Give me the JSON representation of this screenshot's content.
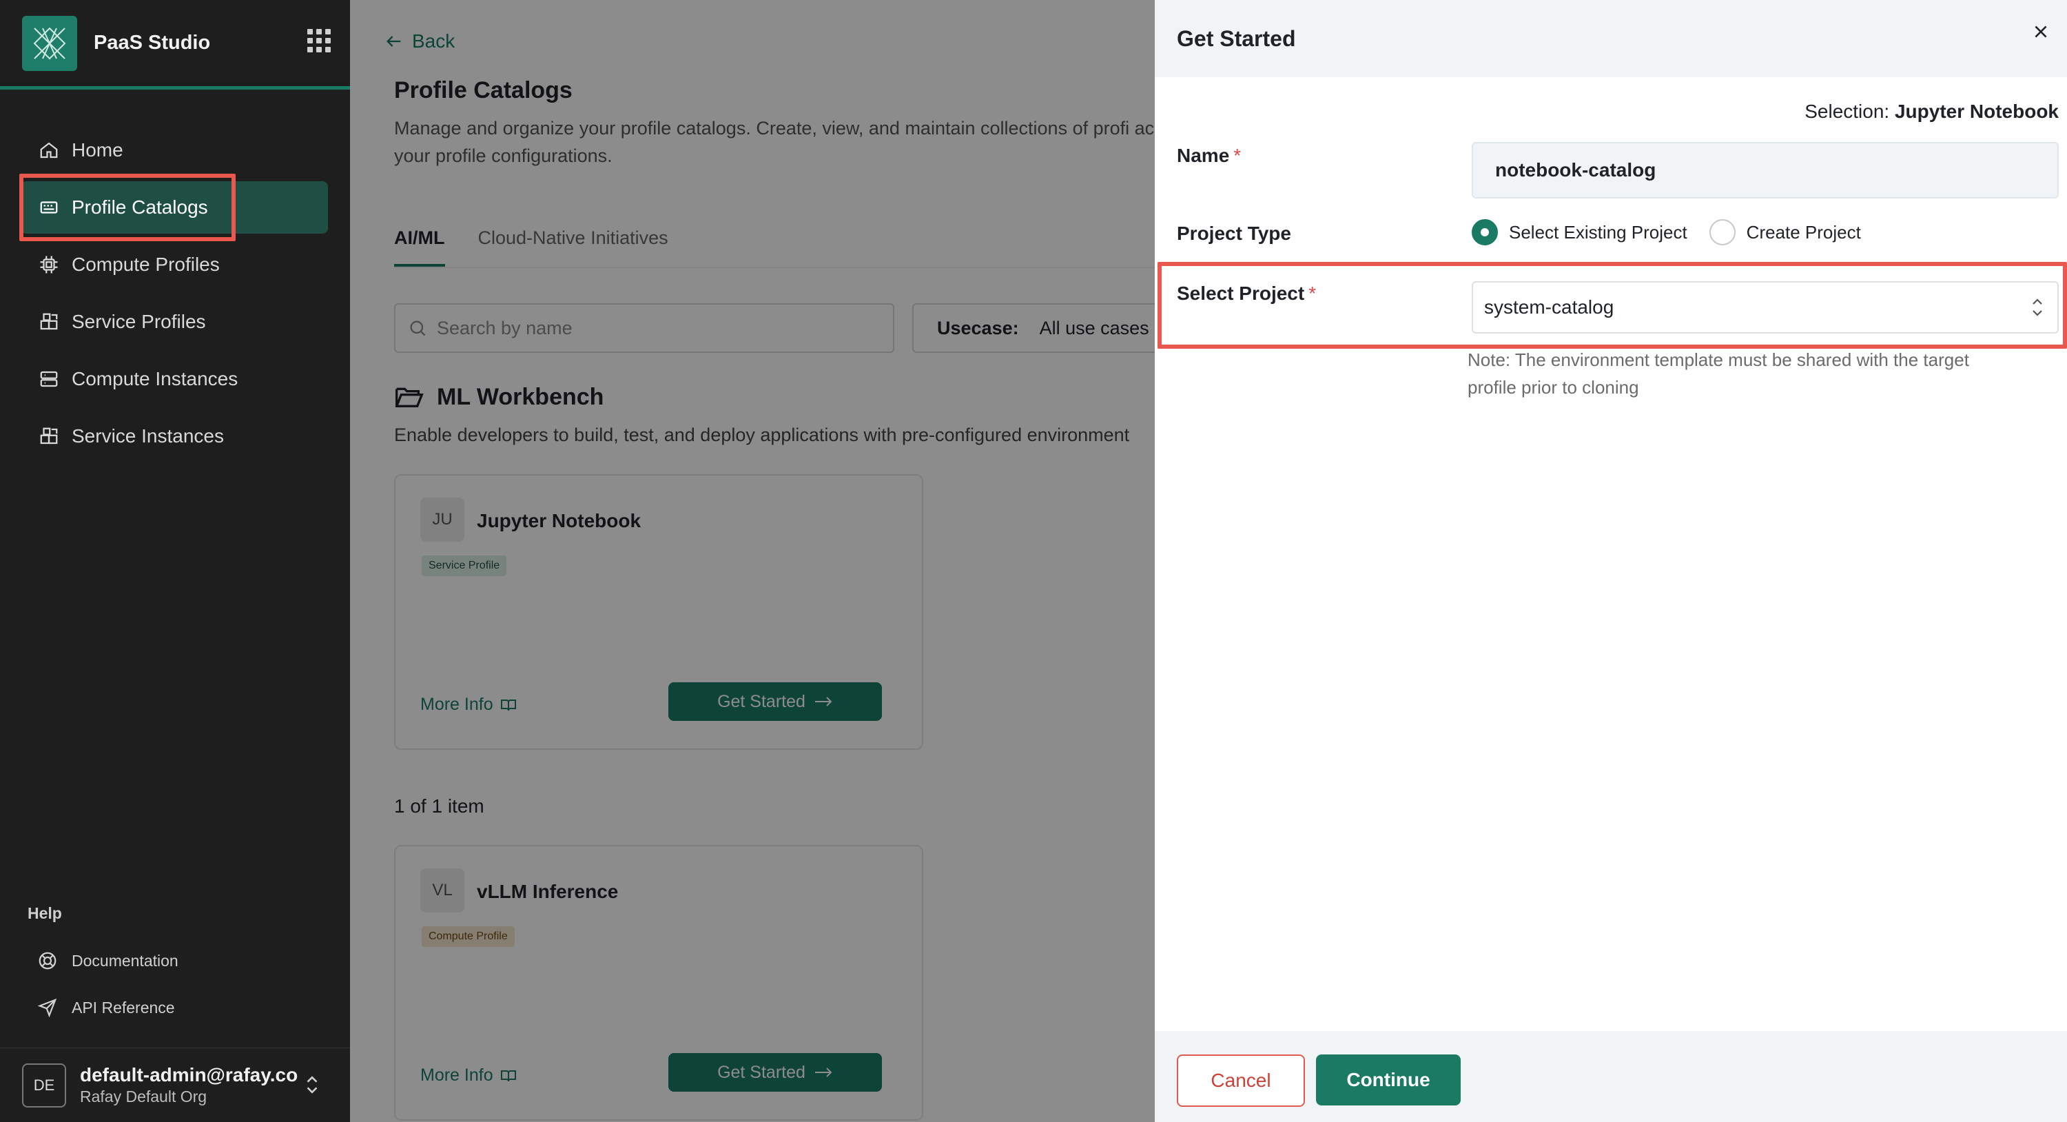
{
  "sidebar": {
    "brand": "PaaS Studio",
    "nav": [
      {
        "label": "Home",
        "icon": "home-icon"
      },
      {
        "label": "Profile Catalogs",
        "icon": "catalog-icon",
        "active": true
      },
      {
        "label": "Compute Profiles",
        "icon": "cpu-icon"
      },
      {
        "label": "Service Profiles",
        "icon": "blocks-icon"
      },
      {
        "label": "Compute Instances",
        "icon": "server-icon"
      },
      {
        "label": "Service Instances",
        "icon": "blocks-icon"
      }
    ],
    "help": {
      "label": "Help",
      "items": [
        {
          "label": "Documentation",
          "icon": "lifebuoy-icon"
        },
        {
          "label": "API Reference",
          "icon": "send-icon"
        }
      ]
    },
    "user": {
      "initials": "DE",
      "email": "default-admin@rafay.co",
      "org": "Rafay Default Org"
    }
  },
  "main": {
    "back": "Back",
    "title": "Profile Catalogs",
    "description": "Manage and organize your profile catalogs. Create, view, and maintain collections of profi access your profile configurations.",
    "tabs": [
      {
        "label": "AI/ML",
        "active": true
      },
      {
        "label": "Cloud-Native Initiatives"
      }
    ],
    "search_placeholder": "Search by name",
    "usecase": {
      "label": "Usecase:",
      "value": "All use cases"
    },
    "section": {
      "title": "ML Workbench",
      "description": "Enable developers to build, test, and deploy applications with pre-configured environment"
    },
    "cards": [
      {
        "initials": "JU",
        "title": "Jupyter Notebook",
        "badge": "Service Profile",
        "more_info": "More Info",
        "button": "Get Started"
      },
      {
        "initials": "VL",
        "title": "vLLM Inference",
        "badge": "Compute Profile",
        "more_info": "More Info",
        "button": "Get Started"
      }
    ],
    "pager": "1 of 1 item"
  },
  "drawer": {
    "title": "Get Started",
    "selection_label": "Selection:",
    "selection_value": "Jupyter Notebook",
    "name_label": "Name",
    "name_value": "notebook-catalog",
    "project_type_label": "Project Type",
    "radio_existing": "Select Existing Project",
    "radio_create": "Create Project",
    "select_project_label": "Select Project",
    "select_project_value": "system-catalog",
    "note": "Note: The environment template must be shared with the target profile prior to cloning",
    "required_mark": "*",
    "cancel": "Cancel",
    "continue": "Continue"
  },
  "colors": {
    "accent": "#1a7a64",
    "highlight": "#e8584e",
    "sidebar_bg": "#1e1e1e"
  }
}
